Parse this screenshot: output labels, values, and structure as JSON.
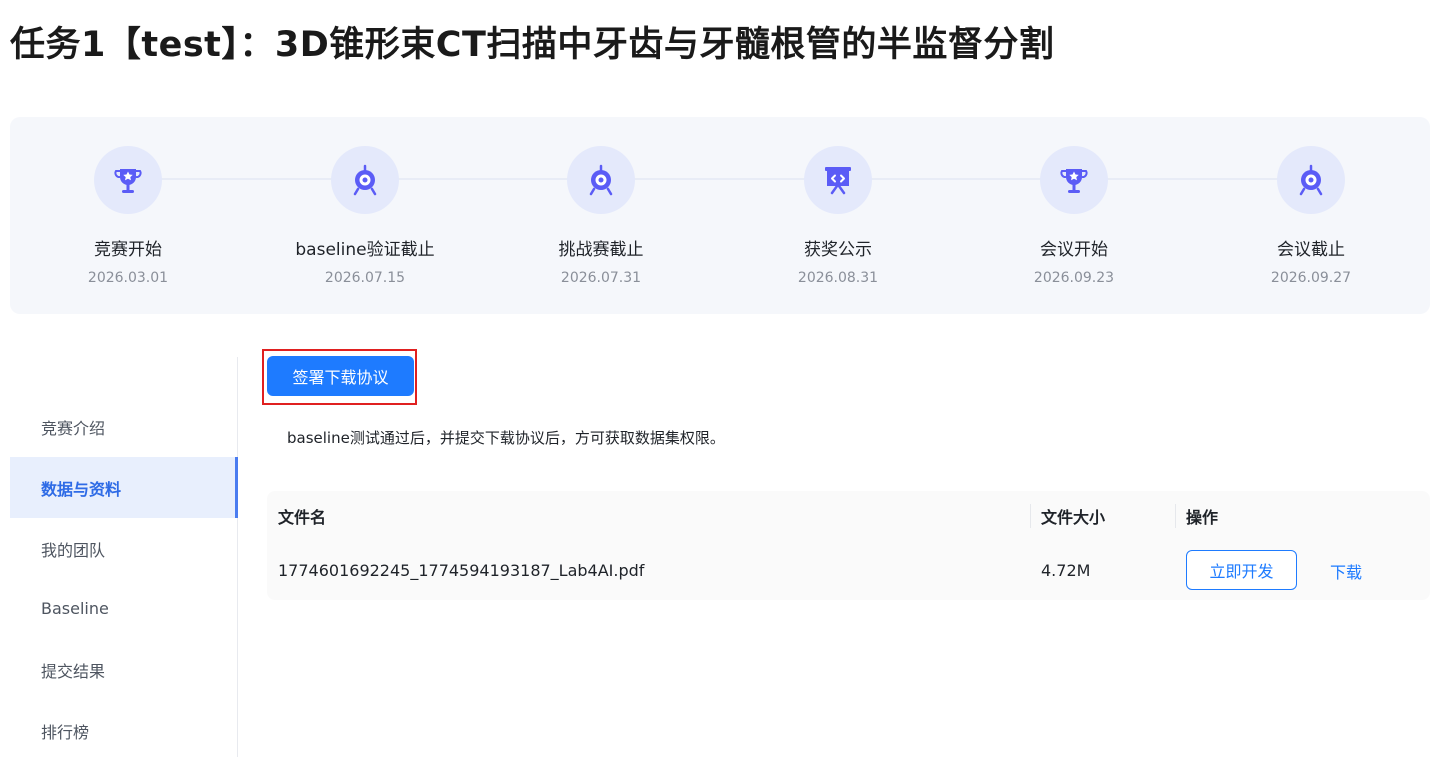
{
  "page": {
    "title": "任务1【test】：3D锥形束CT扫描中牙齿与牙髓根管的半监督分割"
  },
  "timeline": [
    {
      "label": "竞赛开始",
      "date": "2026.03.01",
      "icon": "trophy-icon"
    },
    {
      "label": "baseline验证截止",
      "date": "2026.07.15",
      "icon": "target-icon"
    },
    {
      "label": "挑战赛截止",
      "date": "2026.07.31",
      "icon": "target-icon"
    },
    {
      "label": "获奖公示",
      "date": "2026.08.31",
      "icon": "presentation-board-icon"
    },
    {
      "label": "会议开始",
      "date": "2026.09.23",
      "icon": "trophy-icon"
    },
    {
      "label": "会议截止",
      "date": "2026.09.27",
      "icon": "target-icon"
    }
  ],
  "sidebar": {
    "items": [
      {
        "label": "竞赛介绍",
        "active": false
      },
      {
        "label": "数据与资料",
        "active": true
      },
      {
        "label": "我的团队",
        "active": false
      },
      {
        "label": "Baseline",
        "active": false
      },
      {
        "label": "提交结果",
        "active": false
      },
      {
        "label": "排行榜",
        "active": false
      }
    ]
  },
  "content": {
    "sign_button": "签署下载协议",
    "notice": "baseline测试通过后，并提交下载协议后，方可获取数据集权限。",
    "table": {
      "headers": [
        "文件名",
        "文件大小",
        "操作"
      ],
      "rows": [
        {
          "file_name": "1774601692245_1774594193187_Lab4AI.pdf",
          "file_size": "4.72M",
          "action_develop": "立即开发",
          "action_download": "下载"
        }
      ]
    }
  },
  "colors": {
    "primary": "#1e7bff",
    "active_bg": "#e8effd",
    "icon_accent": "#5b5cf6",
    "highlight_border": "#e02020"
  }
}
